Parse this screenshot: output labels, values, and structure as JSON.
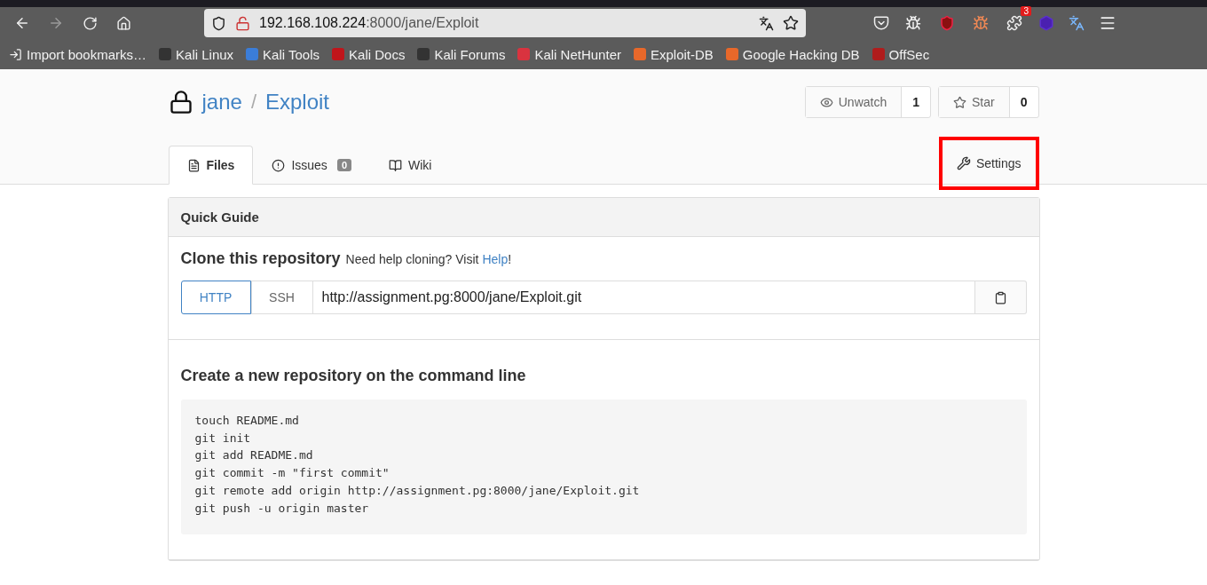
{
  "browser": {
    "url_host": "192.168.108.224",
    "url_path": ":8000/jane/Exploit",
    "extension_badge": "3",
    "bookmarks": [
      {
        "label": "Import bookmarks…",
        "kind": "import"
      },
      {
        "label": "Kali Linux",
        "kind": "kali"
      },
      {
        "label": "Kali Tools",
        "kind": "tools"
      },
      {
        "label": "Kali Docs",
        "kind": "docs"
      },
      {
        "label": "Kali Forums",
        "kind": "kali"
      },
      {
        "label": "Kali NetHunter",
        "kind": "nethunter"
      },
      {
        "label": "Exploit-DB",
        "kind": "exploitdb"
      },
      {
        "label": "Google Hacking DB",
        "kind": "exploitdb"
      },
      {
        "label": "OffSec",
        "kind": "offsec"
      }
    ]
  },
  "repo": {
    "owner": "jane",
    "separator": "/",
    "name": "Exploit",
    "actions": [
      {
        "label": "Unwatch",
        "count": "1",
        "kind": "watch"
      },
      {
        "label": "Star",
        "count": "0",
        "kind": "star"
      }
    ],
    "tabs": [
      {
        "label": "Files",
        "kind": "files",
        "selected": true
      },
      {
        "label": "Issues",
        "kind": "issues",
        "count": "0",
        "selected": false
      },
      {
        "label": "Wiki",
        "kind": "wiki",
        "selected": false
      }
    ],
    "settings": {
      "label": "Settings",
      "highlighted": true
    }
  },
  "guide": {
    "title": "Quick Guide",
    "clone_title": "Clone this repository",
    "clone_help": "Need help cloning? Visit",
    "help_link": "Help",
    "help_end": "!",
    "protocols": [
      {
        "label": "HTTP",
        "selected": true
      },
      {
        "label": "SSH",
        "selected": false
      }
    ],
    "clone_url": "http://assignment.pg:8000/jane/Exploit.git",
    "new_repo_title": "Create a new repository on the command line",
    "commands": [
      "touch README.md",
      "git init",
      "git add README.md",
      "git commit -m \"first commit\"",
      "git remote add origin http://assignment.pg:8000/jane/Exploit.git",
      "git push -u origin master"
    ]
  }
}
